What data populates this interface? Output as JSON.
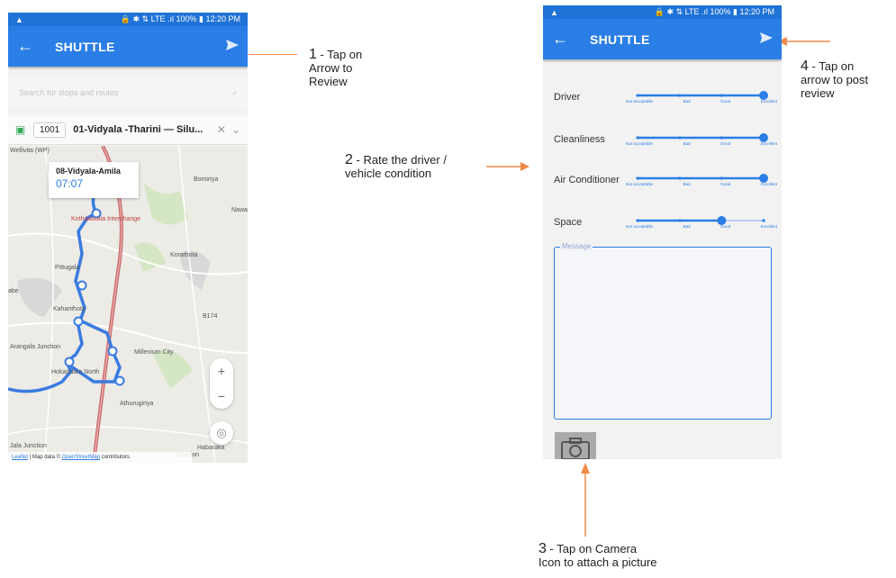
{
  "status_bar": {
    "left_icon": "warning-icon",
    "right_text": "100% ▮ 12:20 PM",
    "icons": "🔒 ✱ ⇅ LTE .ıl"
  },
  "left_screen": {
    "app_title": "SHUTTLE",
    "search_placeholder": "Search for stops and routes",
    "route": {
      "number": "1001",
      "name": "01-Vidyala -Tharini — Silu..."
    },
    "map": {
      "popup_stop": "08-Vidyala-Amila",
      "popup_time": "07:07",
      "labels": [
        "Wellivita (WP)",
        "Bomiriya",
        "Nawa",
        "Kothalawala Interchange",
        "Korathota",
        "Pittugala",
        "abe",
        "Kahanthota",
        "B174",
        "Arangala Junction",
        "Millenium City",
        "Hokandara North",
        "Athurugiriya",
        "Habaraka",
        "Jala Junction",
        "Junction"
      ],
      "attribution_leaflet": "Leaflet",
      "attribution_mid": " | Map data © ",
      "attribution_link": "OpenStreetMap",
      "attribution_end": " contributors"
    },
    "zoom_in": "+",
    "zoom_out": "−"
  },
  "right_screen": {
    "app_title": "SHUTTLE",
    "ratings": [
      {
        "category": "Driver",
        "level": 3
      },
      {
        "category": "Cleanliness",
        "level": 3
      },
      {
        "category": "Air Conditioner",
        "level": 3
      },
      {
        "category": "Space",
        "level": 2
      }
    ],
    "scale_labels": [
      "Not acceptable",
      "Bad",
      "Good",
      "Excellent"
    ],
    "message_label": "Message"
  },
  "annotations": {
    "a1_num": "1",
    "a1_text": " - Tap on",
    "a1_line2": "Arrow to",
    "a1_line3": "Review",
    "a2_num": "2",
    "a2_text": " - Rate the driver /",
    "a2_line2": "vehicle condition",
    "a3_num": "3",
    "a3_text": " - Tap on Camera",
    "a3_line2": "Icon to attach a picture",
    "a4_num": "4",
    "a4_text": " - Tap on",
    "a4_line2": "arrow to post",
    "a4_line3": "review"
  },
  "colors": {
    "accent": "#2a7ee6",
    "status": "#1f72d6",
    "annotation_arrow": "#f08a4b",
    "route_line": "#3a7be0"
  }
}
